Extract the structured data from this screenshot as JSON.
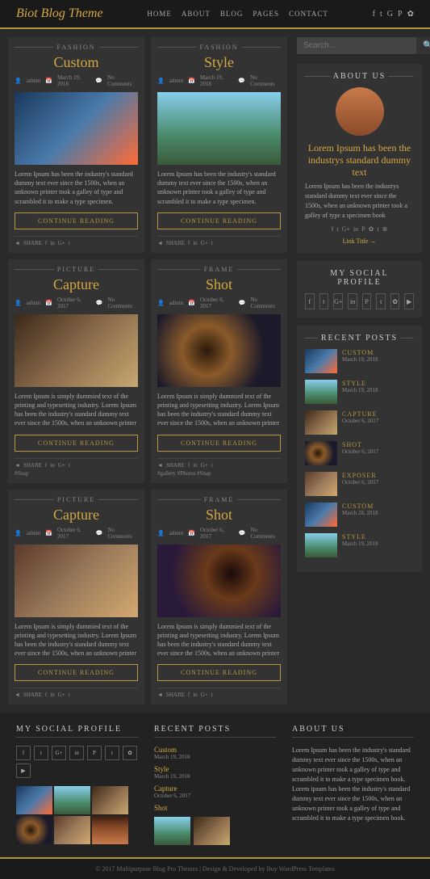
{
  "header": {
    "logo": "Biot Blog Theme",
    "nav": [
      "HOME",
      "ABOUT",
      "BLOG",
      "PAGES",
      "CONTACT"
    ]
  },
  "posts": [
    {
      "category": "FASHION",
      "title": "Custom",
      "author": "admin",
      "date": "March 19, 2018",
      "comments": "No Comments",
      "excerpt": "Lorem Ipsum has been the industry's standard dummy text ever since the 1500s, when an unknown printer took a galley of type and scrambled it to make a type specimen.",
      "img_color": "color-blue",
      "tags": "",
      "continue": "CONTINUE READING"
    },
    {
      "category": "FASHION",
      "title": "Style",
      "author": "admin",
      "date": "March 19, 2018",
      "comments": "No Comments",
      "excerpt": "Lorem Ipsum has been the industry's standard dummy text ever since the 1500s, when an unknown printer took a galley of type and scrambled it to make a type specimen.",
      "img_color": "color-city",
      "tags": "",
      "continue": "CONTINUE READING"
    },
    {
      "category": "PICTURE",
      "title": "Capture",
      "author": "admin",
      "date": "October 6, 2017",
      "comments": "No Comments",
      "excerpt": "Lorem Ipsum is simply dummied text of the printing and typesetting industry. Lorem Ipsum has been the industry's standard dummy text ever since the 1500s, when an unknown printer",
      "img_color": "color-brown",
      "tags": "#Snap",
      "continue": "CONTINUE READING"
    },
    {
      "category": "FRAME",
      "title": "Shot",
      "author": "admin",
      "date": "October 6, 2017",
      "comments": "No Comments",
      "excerpt": "Lorem Ipsum is simply dummied text of the printing and typesetting industry. Lorem Ipsum has been the industry's standard dummy text ever since the 1500s, when an unknown printer",
      "img_color": "color-bokeh",
      "tags": "#gallery #Photos #Snap",
      "continue": "CONTINUE READING"
    },
    {
      "category": "PICTURE",
      "title": "Capture",
      "author": "admin",
      "date": "October 6, 2017",
      "comments": "No Comments",
      "excerpt": "Lorem Ipsum is simply dummied text of the printing and typesetting industry. Lorem Ipsum has been the industry's standard dummy text ever since the 1500s, when an unknown printer",
      "img_color": "color-brown2",
      "tags": "",
      "continue": "CONTINUE READING"
    },
    {
      "category": "FRAME",
      "title": "Shot",
      "author": "admin",
      "date": "October 6, 2017",
      "comments": "No Comments",
      "excerpt": "Lorem Ipsum is simply dummied text of the printing and typesetting industry. Lorem Ipsum has been the industry's standard dummy text ever since the 1500s, when an unknown printer",
      "img_color": "color-bokeh2",
      "tags": "",
      "continue": "CONTINUE READING"
    }
  ],
  "sidebar": {
    "search_placeholder": "Search...",
    "about_widget": {
      "title": "ABOUT US",
      "heading": "Lorem Ipsum has been the industrys standard dummy text",
      "text": "Lorem Ipsum has been the industrys standard dummy text ever since the 1500s, when an unknown printer took a galley of type a specimen book",
      "link": "Link Title"
    },
    "social_widget": {
      "title": "MY SOCIAL PROFILE"
    },
    "recent_posts_widget": {
      "title": "RECENT POSTS",
      "posts": [
        {
          "title": "CUSTOM",
          "date": "March 19, 2018",
          "color": "color-blue"
        },
        {
          "title": "STYLE",
          "date": "March 19, 2018",
          "color": "color-city"
        },
        {
          "title": "CAPTURE",
          "date": "October 6, 2017",
          "color": "color-brown"
        },
        {
          "title": "SHOT",
          "date": "October 6, 2017",
          "color": "color-bokeh"
        },
        {
          "title": "EXPOSER",
          "date": "October 6, 2017",
          "color": "color-brown2"
        },
        {
          "title": "CUSTOM",
          "date": "March 28, 2018",
          "color": "color-blue"
        },
        {
          "title": "STYLE",
          "date": "March 19, 2018",
          "color": "color-city"
        }
      ]
    }
  },
  "footer_widgets": {
    "social": {
      "title": "MY SOCIAL PROFILE"
    },
    "recent": {
      "title": "RECENT POSTS",
      "posts": [
        {
          "title": "Custom",
          "date": "March 19, 2018"
        },
        {
          "title": "Style",
          "date": "March 19, 2018"
        },
        {
          "title": "Capture",
          "date": "October 6, 2017"
        },
        {
          "title": "Shot",
          "date": ""
        }
      ]
    },
    "about": {
      "title": "ABOUT US",
      "text": "Lorem Ipsum has been the industry's standard dummy text ever since the 1500s, when an unknown printer took a galley of type and scrambled it to make a type specimen book. Lorem ipsum has been the industry's standard dummy text ever since the 1500s, when an unknown printer took a galley of type and scrambled it to make a type specimen book."
    }
  },
  "footer": {
    "copyright": "© 2017 Multipurpose Blog Pro Themes | Design & Developed by Buy WordPress Templates"
  },
  "icons": {
    "facebook": "f",
    "twitter": "t",
    "google": "G+",
    "linkedin": "in",
    "pinterest": "p",
    "instagram": "i",
    "youtube": "▶",
    "tumblr": "t",
    "rss": "⊕",
    "share": "◄",
    "search": "🔍"
  }
}
